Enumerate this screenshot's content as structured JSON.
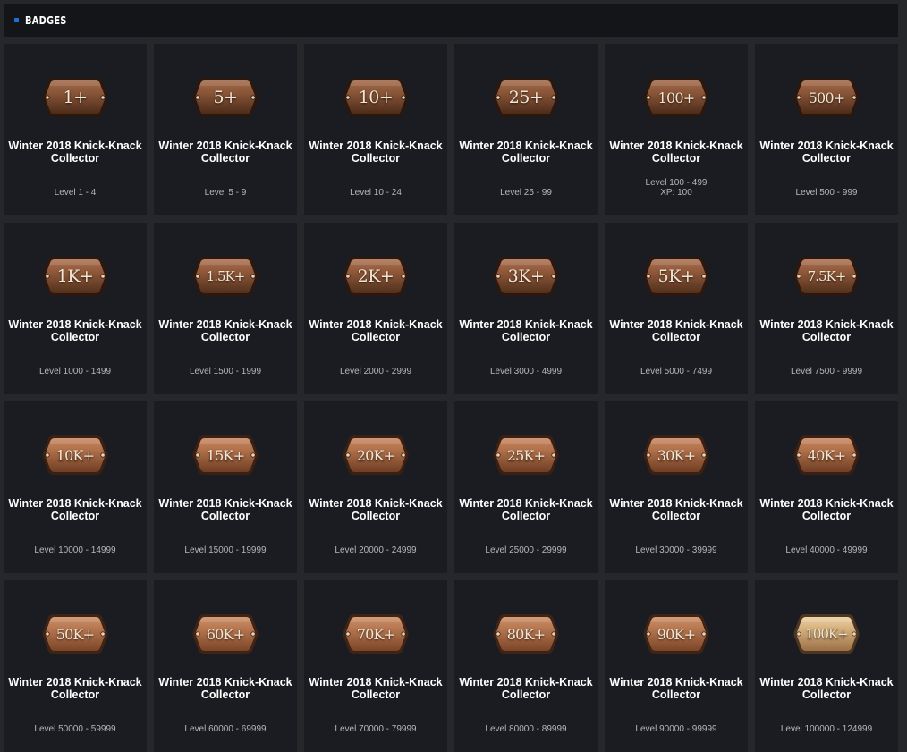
{
  "section": {
    "title": "BADGES",
    "marker_color": "#1e6fd0"
  },
  "badges": [
    {
      "label": "1+",
      "name": "Winter 2018 Knick-Knack Collector",
      "level": "Level 1 - 4",
      "tier": "dark"
    },
    {
      "label": "5+",
      "name": "Winter 2018 Knick-Knack Collector",
      "level": "Level 5 - 9",
      "tier": "dark"
    },
    {
      "label": "10+",
      "name": "Winter 2018 Knick-Knack Collector",
      "level": "Level 10 - 24",
      "tier": "dark"
    },
    {
      "label": "25+",
      "name": "Winter 2018 Knick-Knack Collector",
      "level": "Level 25 - 99",
      "tier": "dark"
    },
    {
      "label": "100+",
      "name": "Winter 2018 Knick-Knack Collector",
      "level": "Level 100 - 499",
      "xp": "XP: 100",
      "tier": "dark"
    },
    {
      "label": "500+",
      "name": "Winter 2018 Knick-Knack Collector",
      "level": "Level 500 - 999",
      "tier": "dark"
    },
    {
      "label": "1K+",
      "name": "Winter 2018 Knick-Knack Collector",
      "level": "Level 1000 - 1499",
      "tier": "mid"
    },
    {
      "label": "1.5K+",
      "name": "Winter 2018 Knick-Knack Collector",
      "level": "Level 1500 - 1999",
      "tier": "mid"
    },
    {
      "label": "2K+",
      "name": "Winter 2018 Knick-Knack Collector",
      "level": "Level 2000 - 2999",
      "tier": "mid"
    },
    {
      "label": "3K+",
      "name": "Winter 2018 Knick-Knack Collector",
      "level": "Level 3000 - 4999",
      "tier": "mid"
    },
    {
      "label": "5K+",
      "name": "Winter 2018 Knick-Knack Collector",
      "level": "Level 5000 - 7499",
      "tier": "mid"
    },
    {
      "label": "7.5K+",
      "name": "Winter 2018 Knick-Knack Collector",
      "level": "Level 7500 - 9999",
      "tier": "mid"
    },
    {
      "label": "10K+",
      "name": "Winter 2018 Knick-Knack Collector",
      "level": "Level 10000 - 14999",
      "tier": "light"
    },
    {
      "label": "15K+",
      "name": "Winter 2018 Knick-Knack Collector",
      "level": "Level 15000 - 19999",
      "tier": "light"
    },
    {
      "label": "20K+",
      "name": "Winter 2018 Knick-Knack Collector",
      "level": "Level 20000 - 24999",
      "tier": "light"
    },
    {
      "label": "25K+",
      "name": "Winter 2018 Knick-Knack Collector",
      "level": "Level 25000 - 29999",
      "tier": "light"
    },
    {
      "label": "30K+",
      "name": "Winter 2018 Knick-Knack Collector",
      "level": "Level 30000 - 39999",
      "tier": "light"
    },
    {
      "label": "40K+",
      "name": "Winter 2018 Knick-Knack Collector",
      "level": "Level 40000 - 49999",
      "tier": "light"
    },
    {
      "label": "50K+",
      "name": "Winter 2018 Knick-Knack Collector",
      "level": "Level 50000 - 59999",
      "tier": "lighter"
    },
    {
      "label": "60K+",
      "name": "Winter 2018 Knick-Knack Collector",
      "level": "Level 60000 - 69999",
      "tier": "lighter"
    },
    {
      "label": "70K+",
      "name": "Winter 2018 Knick-Knack Collector",
      "level": "Level 70000 - 79999",
      "tier": "lighter"
    },
    {
      "label": "80K+",
      "name": "Winter 2018 Knick-Knack Collector",
      "level": "Level 80000 - 89999",
      "tier": "lighter"
    },
    {
      "label": "90K+",
      "name": "Winter 2018 Knick-Knack Collector",
      "level": "Level 90000 - 99999",
      "tier": "lighter"
    },
    {
      "label": "100K+",
      "name": "Winter 2018 Knick-Knack Collector",
      "level": "Level 100000 - 124999",
      "tier": "gold"
    }
  ],
  "tier_colors": {
    "dark": {
      "top": "#8a5638",
      "bottom": "#4a2a19",
      "rim": "#2a170d",
      "hi": "#a2694a"
    },
    "mid": {
      "top": "#91593a",
      "bottom": "#50301c",
      "rim": "#2c180e",
      "hi": "#ab7252"
    },
    "light": {
      "top": "#b0704a",
      "bottom": "#6e3e24",
      "rim": "#3a2012",
      "hi": "#c88862"
    },
    "lighter": {
      "top": "#b5764f",
      "bottom": "#7a4528",
      "rim": "#3f2314",
      "hi": "#cd9068"
    },
    "gold": {
      "top": "#d6b07c",
      "bottom": "#9a7048",
      "rim": "#4e3520",
      "hi": "#ecd0a4"
    }
  }
}
